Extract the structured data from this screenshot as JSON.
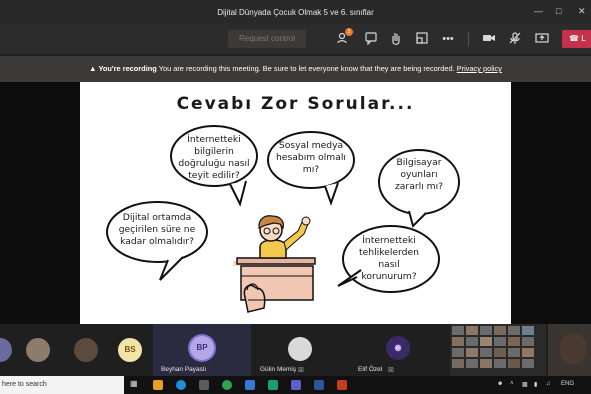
{
  "window": {
    "title": "Dijital Dünyada Çocuk Olmak 5 ve 6. sınıflar"
  },
  "toolbar": {
    "request_control_label": "Request control",
    "participants_badge": "1",
    "leave_label": "L"
  },
  "recording": {
    "label": "You're recording",
    "message": "You are recording this meeting. Be sure to let everyone know that they are being recorded.",
    "link": "Privacy policy"
  },
  "slide": {
    "title": "Cevabı Zor Sorular...",
    "bubbles": [
      {
        "text": "İnternetteki bilgilerin doğruluğu nasıl teyit edilir?"
      },
      {
        "text": "Sosyal medya hesabım olmalı mı?"
      },
      {
        "text": "Bilgisayar oyunları zararlı mı?"
      },
      {
        "text": "Dijital ortamda geçirilen süre ne kadar olmalıdır?"
      },
      {
        "text": "İnternetteki tehlikelerden nasıl korunurum?"
      }
    ]
  },
  "participants": [
    {
      "initials": "BS",
      "name": ""
    },
    {
      "initials": "BP",
      "name": "Beyhan Payaslı"
    },
    {
      "initials": "",
      "name": "Gülin Memiş"
    },
    {
      "initials": "",
      "name": "Elif Özel"
    }
  ],
  "taskbar": {
    "search_placeholder": "here to search",
    "language": "ENG"
  },
  "colors": {
    "leave_red": "#c4314b",
    "avatar_bs": "#f2e3a6",
    "avatar_bp": "#b4a7e6",
    "bubble_stroke": "#111111"
  }
}
